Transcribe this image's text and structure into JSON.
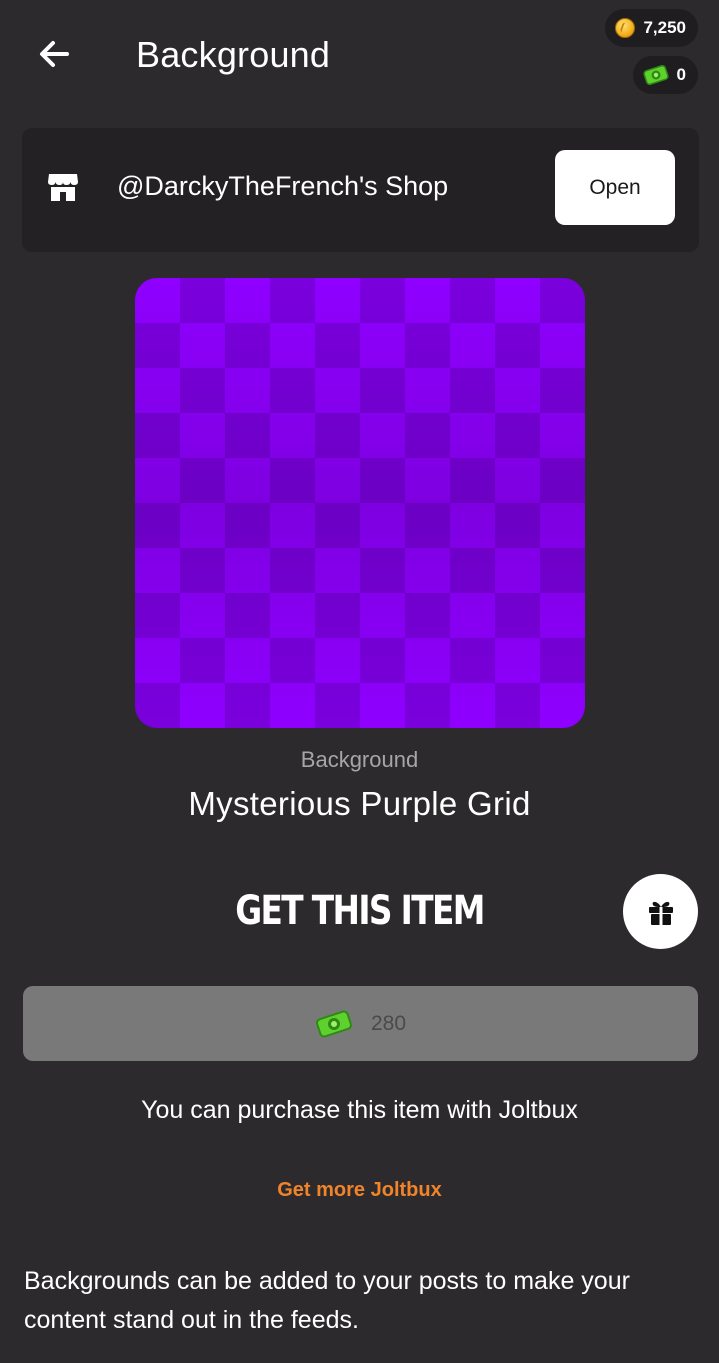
{
  "header": {
    "title": "Background",
    "back_icon": "arrow-left-icon",
    "coins_balance": "7,250",
    "joltbux_balance": "0"
  },
  "shop": {
    "name": "@DarckyTheFrench's Shop",
    "icon": "storefront-icon",
    "open_label": "Open"
  },
  "item": {
    "preview_colors": [
      "#8f00ff",
      "#7a00dd"
    ],
    "type": "Background",
    "name": "Mysterious Purple Grid"
  },
  "purchase": {
    "heading": "GET THIS ITEM",
    "gift_icon": "gift-icon",
    "price": "280",
    "currency_icon": "joltbux-icon",
    "note": "You can purchase this item with Joltbux",
    "get_more_label": "Get more Joltbux"
  },
  "description": "Backgrounds can be added to your posts to make your content stand out in the feeds.",
  "colors": {
    "background": "#2c2a2c",
    "card": "#232123",
    "accent_orange": "#f0842a",
    "price_button": "#7a797a"
  }
}
